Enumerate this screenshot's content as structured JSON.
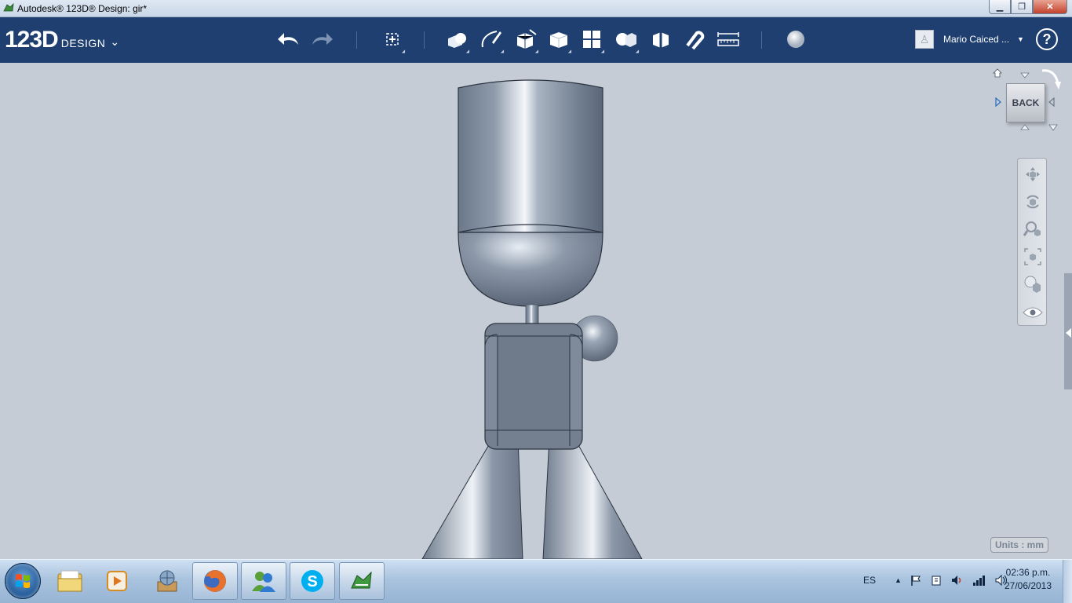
{
  "window": {
    "title": "Autodesk® 123D® Design: gir*",
    "min_label": "▁",
    "max_label": "❐",
    "close_label": "✕"
  },
  "toolbar": {
    "logo_big": "123D",
    "logo_small": "DESIGN",
    "logo_caret": "⌄",
    "icons": [
      "undo-icon",
      "redo-icon",
      "transform-icon",
      "primitives-icon",
      "sketch-icon",
      "construct-icon",
      "modify-icon",
      "pattern-icon",
      "group-icon",
      "combine-icon",
      "snap-icon",
      "measure-icon",
      "material-icon"
    ]
  },
  "user": {
    "name": "Mario Caiced ...",
    "caret": "▼",
    "avatar_glyph": "♙"
  },
  "help_label": "?",
  "viewcube": {
    "face_label": "BACK"
  },
  "units_label": "Units : mm",
  "taskbar": {
    "apps": [
      "file-explorer-icon",
      "media-player-icon",
      "library-icon",
      "firefox-icon",
      "messenger-icon",
      "skype-icon",
      "123d-design-icon"
    ],
    "language": "ES",
    "tray_up": "▲",
    "time": "02:36 p.m.",
    "date": "27/06/2013"
  },
  "colors": {
    "toolbar_bg": "#1e3f6f",
    "viewport_bg": "#c5ccd6",
    "model_metal": "#7b8a9c"
  }
}
